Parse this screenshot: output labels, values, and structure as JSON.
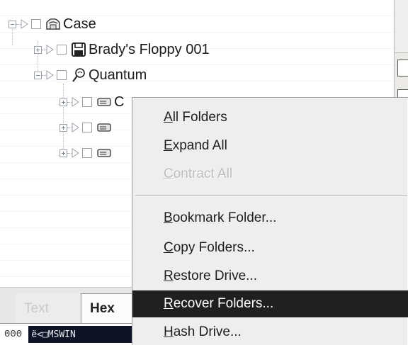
{
  "tree": {
    "nodes": [
      {
        "label": "Case",
        "icon": "case-icon",
        "expander": "minus"
      },
      {
        "label": "Brady's Floppy 001",
        "icon": "floppy-disk-icon",
        "expander": "plus"
      },
      {
        "label": "Quantum",
        "icon": "hard-drive-magnifier-icon",
        "expander": "minus"
      },
      {
        "label": "C",
        "icon": "drive-icon",
        "expander": "plus"
      },
      {
        "label": "",
        "icon": "drive-icon",
        "expander": "plus"
      },
      {
        "label": "",
        "icon": "drive-icon",
        "expander": "plus"
      }
    ]
  },
  "tabs": {
    "text_label": "Text",
    "hex_label": "Hex"
  },
  "hex_view": {
    "offset": "000",
    "data": "ë<□MSWIN"
  },
  "context_menu": {
    "items": [
      {
        "label": "All Folders",
        "accel": "A",
        "rest": "ll Folders",
        "state": "normal"
      },
      {
        "label": "Expand All",
        "accel": "E",
        "rest": "xpand All",
        "state": "normal"
      },
      {
        "label": "Contract All",
        "accel": "C",
        "rest": "ontract All",
        "state": "disabled"
      },
      {
        "label": "Bookmark Folder...",
        "accel": "B",
        "rest": "ookmark Folder...",
        "state": "normal"
      },
      {
        "label": "Copy Folders...",
        "accel": "C",
        "rest": "opy Folders...",
        "state": "normal"
      },
      {
        "label": "Restore Drive...",
        "accel": "R",
        "rest": "estore Drive...",
        "state": "normal"
      },
      {
        "label": "Recover Folders...",
        "accel": "R",
        "rest": "ecover Folders...",
        "state": "highlighted"
      },
      {
        "label": "Hash Drive...",
        "accel": "H",
        "rest": "ash Drive...",
        "state": "normal"
      }
    ]
  },
  "colors": {
    "highlight": "#202020",
    "menu_background": "#eeeeee",
    "hex_selection": "#0e1426",
    "disabled_text": "#bdbdbd"
  }
}
